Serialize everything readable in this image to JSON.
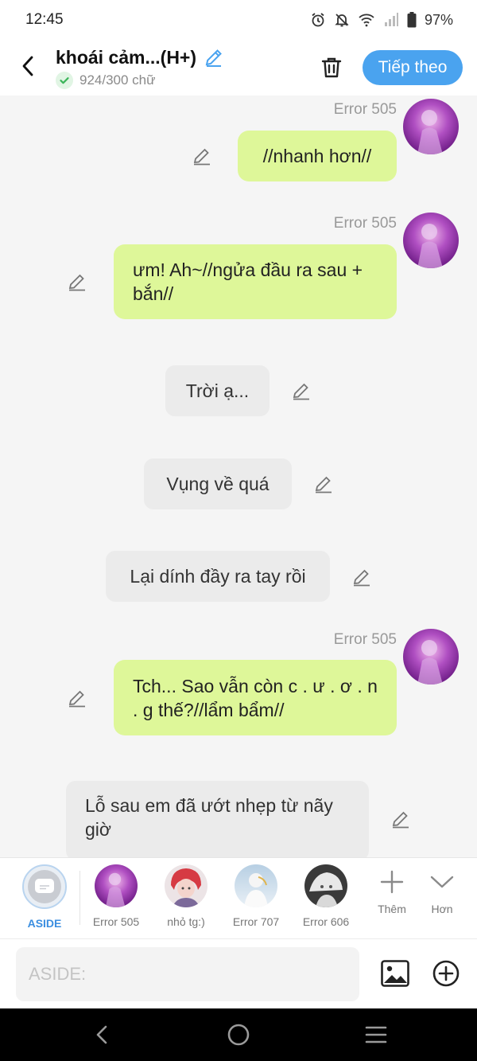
{
  "status": {
    "time": "12:45",
    "battery": "97%"
  },
  "header": {
    "title": "khoái cảm...(H+)",
    "word_count": "924/300 chữ",
    "next_label": "Tiếp theo"
  },
  "messages": [
    {
      "sender": "Error 505",
      "text": "//nhanh hơn//",
      "side": "right"
    },
    {
      "sender": "Error 505",
      "text": "ưm! Ah~//ngửa đầu ra sau + bắn//",
      "side": "right"
    },
    {
      "text": "Trời ạ...",
      "side": "center"
    },
    {
      "text": "Vụng về quá",
      "side": "center"
    },
    {
      "text": "Lại dính đầy ra tay rồi",
      "side": "center"
    },
    {
      "sender": "Error 505",
      "text": "Tch... Sao vẫn còn c . ư . ơ . n . g thế?//lẩm bẩm//",
      "side": "right"
    },
    {
      "text": "Lỗ sau em đã ướt nhẹp từ nãy giờ",
      "side": "left"
    }
  ],
  "characters": [
    {
      "label": "ASIDE",
      "selected": true
    },
    {
      "label": "Error 505"
    },
    {
      "label": "nhỏ tg:)"
    },
    {
      "label": "Error 707"
    },
    {
      "label": "Error 606"
    }
  ],
  "tools": {
    "more_label": "Thêm",
    "expand_label": "Hơn"
  },
  "input": {
    "placeholder": "ASIDE:",
    "value": ""
  },
  "colors": {
    "accent": "#4aa3ef",
    "bubble_right": "#def799",
    "bubble_neutral": "#ebebeb"
  }
}
